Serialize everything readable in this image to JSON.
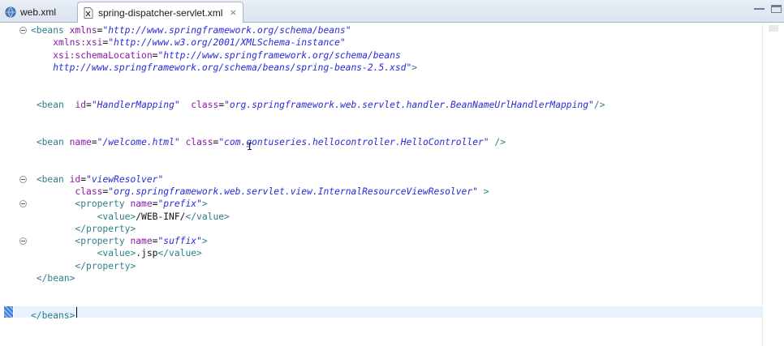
{
  "tabs": [
    {
      "label": "web.xml",
      "active": false,
      "icon": "globe-xml-icon"
    },
    {
      "label": "spring-dispatcher-servlet.xml",
      "active": true,
      "icon": "xml-file-icon",
      "close_glyph": "⨯"
    }
  ],
  "window_controls": [
    "minimize-icon",
    "maximize-icon"
  ],
  "colors": {
    "tag": "#2d7f8c",
    "attribute": "#8a1aa6",
    "value": "#2a2ad8",
    "text": "#111111",
    "current_line": "#e8f2fe"
  },
  "editor": {
    "lines": [
      [
        {
          "k": "t",
          "s": "<beans "
        },
        {
          "k": "a",
          "s": "xmlns"
        },
        {
          "k": "x",
          "s": "="
        },
        {
          "k": "v",
          "s": "\"http://www.springframework.org/schema/beans\""
        }
      ],
      [
        {
          "k": "x",
          "s": "    "
        },
        {
          "k": "a",
          "s": "xmlns:xsi"
        },
        {
          "k": "x",
          "s": "="
        },
        {
          "k": "v",
          "s": "\"http://www.w3.org/2001/XMLSchema-instance\""
        }
      ],
      [
        {
          "k": "x",
          "s": "    "
        },
        {
          "k": "a",
          "s": "xsi:schemaLocation"
        },
        {
          "k": "x",
          "s": "="
        },
        {
          "k": "v",
          "s": "\"http://www.springframework.org/schema/beans"
        }
      ],
      [
        {
          "k": "v",
          "s": "    http://www.springframework.org/schema/beans/spring-beans-2.5.xsd\""
        },
        {
          "k": "t",
          "s": ">"
        }
      ],
      [],
      [],
      [
        {
          "k": "x",
          "s": " "
        },
        {
          "k": "t",
          "s": "<bean"
        },
        {
          "k": "x",
          "s": "  "
        },
        {
          "k": "a",
          "s": "id"
        },
        {
          "k": "x",
          "s": "="
        },
        {
          "k": "v",
          "s": "\"HandlerMapping\""
        },
        {
          "k": "x",
          "s": "  "
        },
        {
          "k": "a",
          "s": "class"
        },
        {
          "k": "x",
          "s": "="
        },
        {
          "k": "v",
          "s": "\"org.springframework.web.servlet.handler.BeanNameUrlHandlerMapping\""
        },
        {
          "k": "t",
          "s": "/>"
        }
      ],
      [],
      [],
      [
        {
          "k": "x",
          "s": " "
        },
        {
          "k": "t",
          "s": "<bean "
        },
        {
          "k": "a",
          "s": "name"
        },
        {
          "k": "x",
          "s": "="
        },
        {
          "k": "v",
          "s": "\"/welcome.html\""
        },
        {
          "k": "x",
          "s": " "
        },
        {
          "k": "a",
          "s": "class"
        },
        {
          "k": "x",
          "s": "="
        },
        {
          "k": "v",
          "s": "\"com.gontuseries.hellocontroller.HelloController\""
        },
        {
          "k": "x",
          "s": " "
        },
        {
          "k": "t",
          "s": "/>"
        }
      ],
      [],
      [],
      [
        {
          "k": "x",
          "s": " "
        },
        {
          "k": "t",
          "s": "<bean "
        },
        {
          "k": "a",
          "s": "id"
        },
        {
          "k": "x",
          "s": "="
        },
        {
          "k": "v",
          "s": "\"viewResolver\""
        }
      ],
      [
        {
          "k": "x",
          "s": "        "
        },
        {
          "k": "a",
          "s": "class"
        },
        {
          "k": "x",
          "s": "="
        },
        {
          "k": "v",
          "s": "\"org.springframework.web.servlet.view.InternalResourceViewResolver\""
        },
        {
          "k": "x",
          "s": " "
        },
        {
          "k": "t",
          "s": ">"
        }
      ],
      [
        {
          "k": "x",
          "s": "        "
        },
        {
          "k": "t",
          "s": "<property "
        },
        {
          "k": "a",
          "s": "name"
        },
        {
          "k": "x",
          "s": "="
        },
        {
          "k": "v",
          "s": "\"prefix\""
        },
        {
          "k": "t",
          "s": ">"
        }
      ],
      [
        {
          "k": "x",
          "s": "            "
        },
        {
          "k": "t",
          "s": "<value>"
        },
        {
          "k": "x",
          "s": "/WEB-INF/"
        },
        {
          "k": "t",
          "s": "</value>"
        }
      ],
      [
        {
          "k": "x",
          "s": "        "
        },
        {
          "k": "t",
          "s": "</property>"
        }
      ],
      [
        {
          "k": "x",
          "s": "        "
        },
        {
          "k": "t",
          "s": "<property "
        },
        {
          "k": "a",
          "s": "name"
        },
        {
          "k": "x",
          "s": "="
        },
        {
          "k": "v",
          "s": "\"suffix\""
        },
        {
          "k": "t",
          "s": ">"
        }
      ],
      [
        {
          "k": "x",
          "s": "            "
        },
        {
          "k": "t",
          "s": "<value>"
        },
        {
          "k": "x",
          "s": ".jsp"
        },
        {
          "k": "t",
          "s": "</value>"
        }
      ],
      [
        {
          "k": "x",
          "s": "        "
        },
        {
          "k": "t",
          "s": "</property>"
        }
      ],
      [
        {
          "k": "x",
          "s": " "
        },
        {
          "k": "t",
          "s": "</bean>"
        }
      ],
      [],
      [],
      [
        {
          "k": "t",
          "s": "</beans>"
        }
      ]
    ],
    "fold_lines": [
      0,
      12,
      14,
      17
    ],
    "current_line": 23
  }
}
